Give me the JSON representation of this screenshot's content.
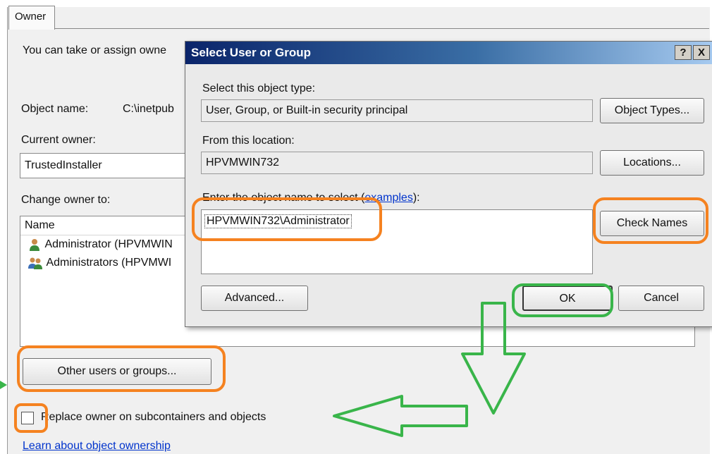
{
  "owner_tab": {
    "label": "Owner"
  },
  "intro_text": "You can take or assign owne",
  "object_name": {
    "label": "Object name:",
    "value": "C:\\inetpub"
  },
  "current_owner": {
    "label": "Current owner:",
    "value": "TrustedInstaller"
  },
  "change_owner": {
    "label": "Change owner to:",
    "column_header": "Name",
    "items": [
      {
        "label": "Administrator (HPVMWIN",
        "icon": "user-icon"
      },
      {
        "label": "Administrators (HPVMWI",
        "icon": "group-icon"
      }
    ]
  },
  "other_users_button": "Other users or groups...",
  "replace_owner_checkbox": {
    "label": "Replace owner on subcontainers and objects",
    "checked": false
  },
  "learn_link": "Learn about object ownership",
  "dialog": {
    "title": "Select User or Group",
    "help_button": "?",
    "close_button": "X",
    "object_type_label": "Select this object type:",
    "object_type_value": "User, Group, or Built-in security principal",
    "object_types_button": "Object Types...",
    "location_label": "From this location:",
    "location_value": "HPVMWIN732",
    "locations_button": "Locations...",
    "enter_name_label": "Enter the object name to select (",
    "examples_link": "examples",
    "enter_name_suffix": "):",
    "object_name_value": "HPVMWIN732\\Administrator",
    "check_names_button": "Check Names",
    "advanced_button": "Advanced...",
    "ok_button": "OK",
    "cancel_button": "Cancel"
  },
  "colors": {
    "annotation_orange": "#f58220",
    "annotation_green": "#39b54a",
    "title_bar": "#0a246a"
  }
}
